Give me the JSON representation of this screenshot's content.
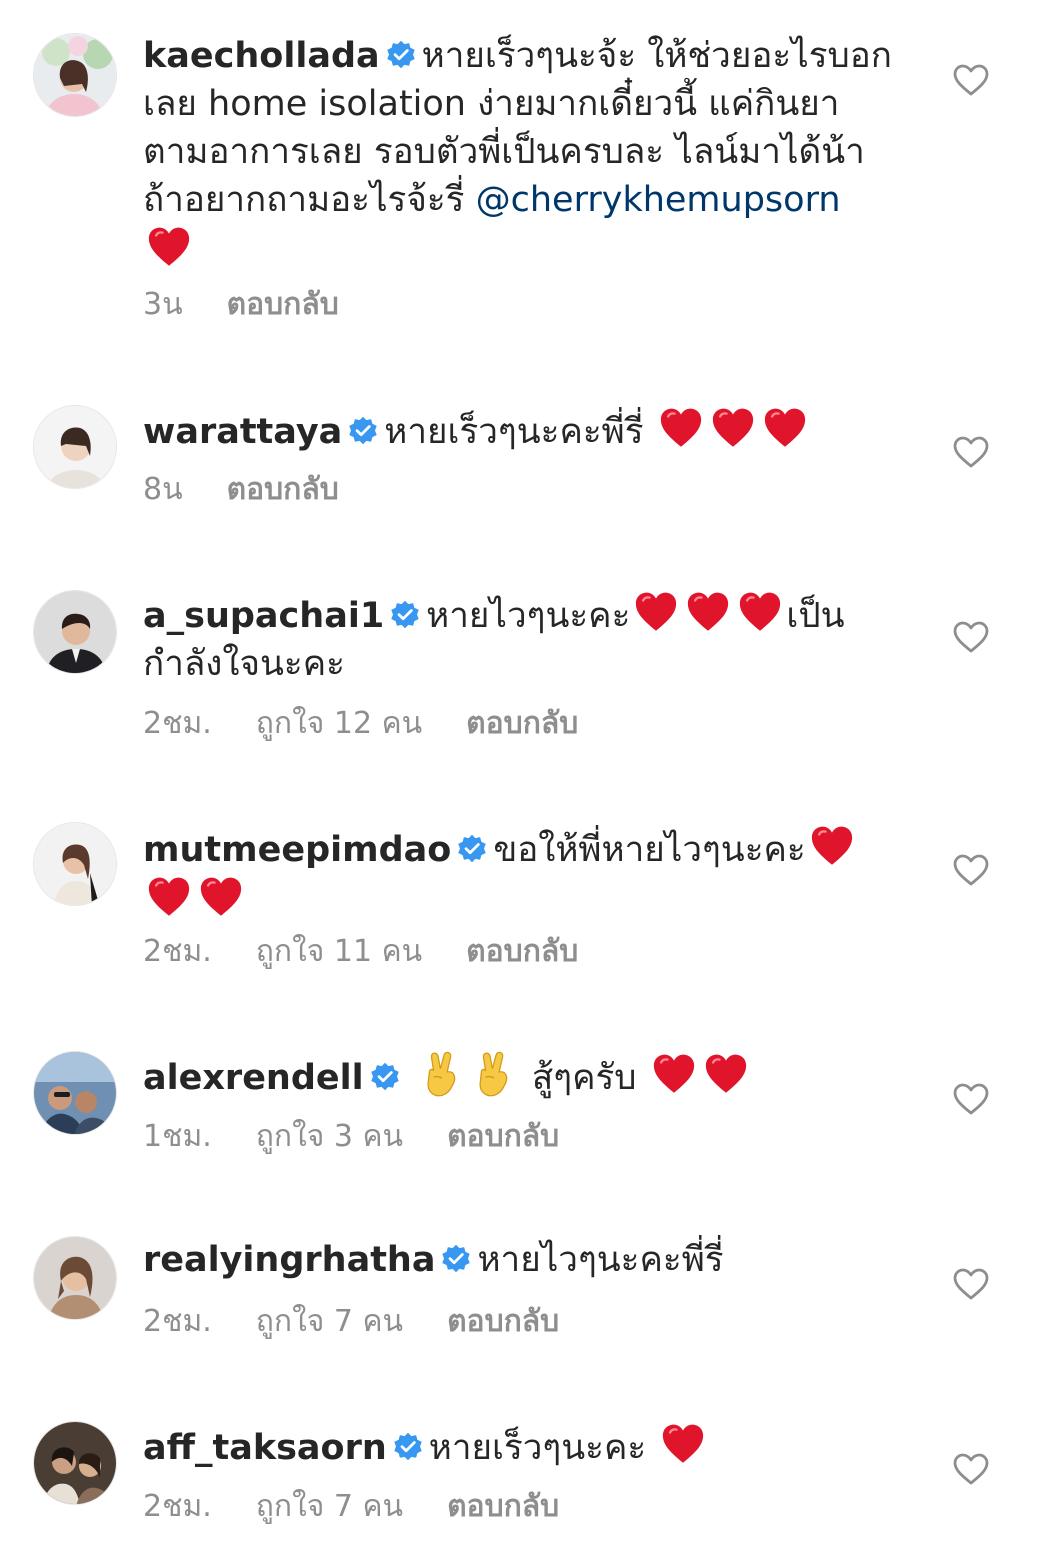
{
  "colors": {
    "text": "#262626",
    "secondary": "#8e8e8e",
    "mention": "#00376b",
    "verified": "#3897f0",
    "heart": "#e0142b"
  },
  "comments": [
    {
      "username": "kaechollada",
      "text_1": "หายเร็วๆนะจ้ะ ให้ช่วยอะไรบอกเลย home isolation ง่ายมากเดี๋ยวนี้ แค่กินยาตามอาการเลย รอบตัวพี่เป็นครบละ ไลน์มาได้น้าถ้าอยากถามอะไรจ้ะรี่",
      "mention": "@cherrykhemupsorn",
      "time": "3น",
      "likes": "",
      "reply": "ตอบกลับ"
    },
    {
      "username": "warattaya",
      "text_1": "หายเร็วๆนะคะพี่รี่",
      "time": "8น",
      "likes": "",
      "reply": "ตอบกลับ"
    },
    {
      "username": "a_supachai1",
      "text_1": "หายไวๆนะคะ",
      "text_2": "เป็นกำลังใจนะคะ",
      "time": "2ชม.",
      "likes": "ถูกใจ 12 คน",
      "reply": "ตอบกลับ"
    },
    {
      "username": "mutmeepimdao",
      "text_1": "ขอให้พี่หายไวๆนะคะ",
      "time": "2ชม.",
      "likes": "ถูกใจ 11 คน",
      "reply": "ตอบกลับ"
    },
    {
      "username": "alexrendell",
      "text_1": "สู้ๆครับ",
      "time": "1ชม.",
      "likes": "ถูกใจ 3 คน",
      "reply": "ตอบกลับ"
    },
    {
      "username": "realyingrhatha",
      "text_1": "หายไวๆนะคะพี่รี่",
      "time": "2ชม.",
      "likes": "ถูกใจ 7 คน",
      "reply": "ตอบกลับ"
    },
    {
      "username": "aff_taksaorn",
      "text_1": "หายเร็วๆนะคะ",
      "time": "2ชม.",
      "likes": "ถูกใจ 7 คน",
      "reply": "ตอบกลับ"
    }
  ]
}
